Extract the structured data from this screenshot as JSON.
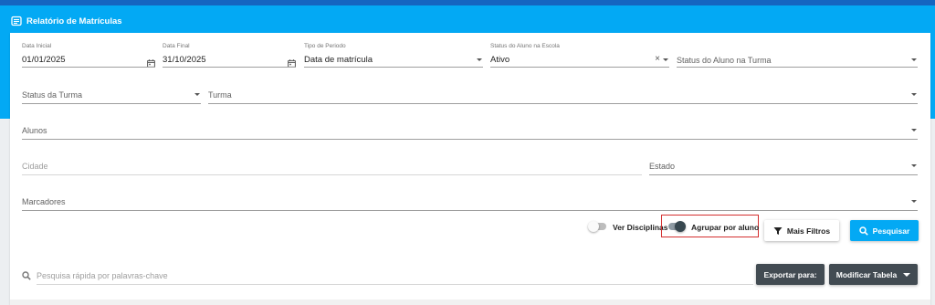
{
  "header": {
    "title": "Relatório de Matrículas"
  },
  "filters": {
    "data_inicial": {
      "label": "Data Inicial",
      "value": "01/01/2025"
    },
    "data_final": {
      "label": "Data Final",
      "value": "31/10/2025"
    },
    "tipo_periodo": {
      "label": "Tipo de Periodo",
      "value": "Data de matrícula"
    },
    "status_aluno_escola": {
      "label": "Status do Aluno na Escola",
      "value": "Ativo",
      "clear_symbol": "×"
    },
    "status_aluno_turma": {
      "placeholder": "Status do Aluno na Turma"
    },
    "status_turma": {
      "placeholder": "Status da Turma"
    },
    "turma": {
      "placeholder": "Turma"
    },
    "alunos": {
      "placeholder": "Alunos"
    },
    "cidade": {
      "placeholder": "Cidade"
    },
    "estado": {
      "placeholder": "Estado"
    },
    "marcadores": {
      "placeholder": "Marcadores"
    }
  },
  "toggles": {
    "ver_disciplinas": {
      "label": "Ver Disciplinas",
      "on": false
    },
    "agrupar_por_aluno": {
      "label": "Agrupar por aluno",
      "on": true
    }
  },
  "buttons": {
    "mais_filtros": "Mais Filtros",
    "pesquisar": "Pesquisar",
    "exportar": "Exportar para:",
    "modificar_tabela": "Modificar Tabela"
  },
  "search": {
    "placeholder": "Pesquisa rápida por palavras-chave"
  },
  "icons": {
    "header": "report-icon",
    "calendar": "calendar-icon",
    "dropdown": "caret-down-icon",
    "filter": "filter-icon",
    "search": "search-icon"
  },
  "colors": {
    "topbar": "#1565c0",
    "header": "#03a9f4",
    "primary_button": "#03a9f4",
    "dark_button": "#424b52",
    "highlight": "#d32f2f"
  }
}
